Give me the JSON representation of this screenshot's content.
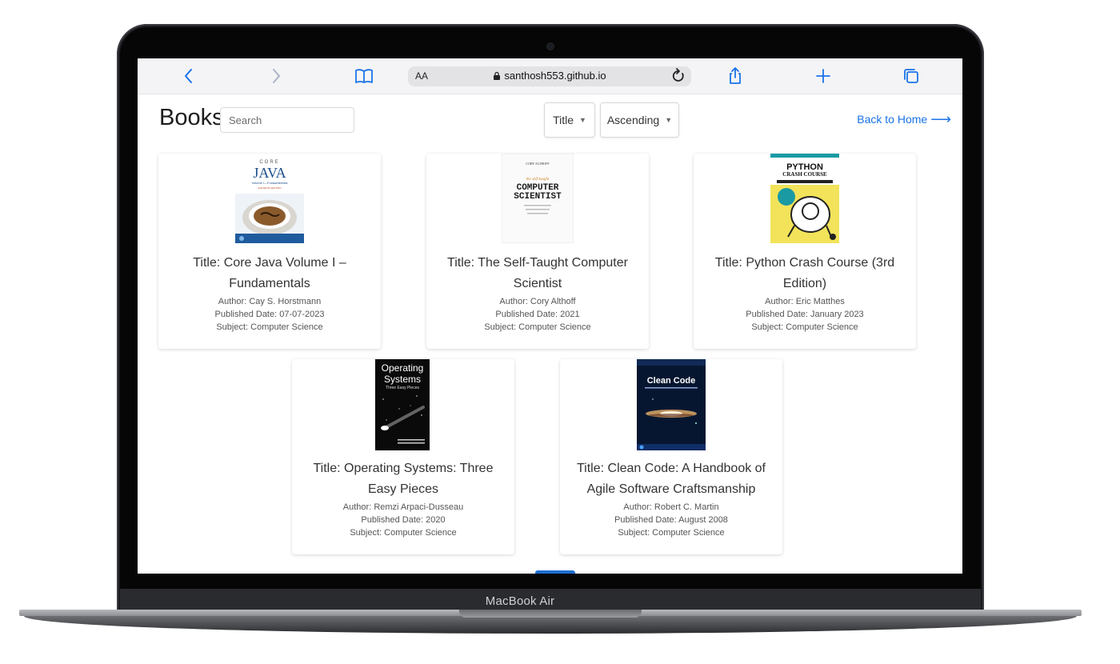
{
  "browser": {
    "aa_label": "AA",
    "url": "santhosh553.github.io",
    "icons": [
      "chevron-left-icon",
      "chevron-right-icon",
      "book-open-icon",
      "reload-icon",
      "share-icon",
      "plus-icon",
      "tabs-icon",
      "lock-icon"
    ]
  },
  "device": {
    "label": "MacBook Air"
  },
  "page": {
    "heading": "Books",
    "search_placeholder": "Search",
    "sort_field": "Title",
    "sort_order": "Ascending",
    "back_link": "Back to Home"
  },
  "cover_texts": {
    "java": {
      "top": "CORE",
      "name": "JAVA",
      "sub": "Volume I—Fundamentals",
      "ed": "ELEVENTH EDITION"
    },
    "cs": {
      "author": "CORY ALTHOFF",
      "tag": "the self-taught",
      "l1": "COMPUTER",
      "l2": "SCIENTIST"
    },
    "py": {
      "badge": "THIRD EDITION",
      "l1": "PYTHON",
      "l2": "CRASH COURSE"
    },
    "os": {
      "l1": "Operating",
      "l2": "Systems",
      "l3": "Three Easy Pieces"
    },
    "cc": {
      "l1": "Clean Code"
    }
  },
  "books": [
    {
      "title": "Title: Core Java Volume I – Fundamentals",
      "author": "Author: Cay S. Horstmann",
      "date": "Published Date: 07-07-2023",
      "subject": "Subject: Computer Science"
    },
    {
      "title": "Title: The Self-Taught Computer Scientist",
      "author": "Author: Cory Althoff",
      "date": "Published Date: 2021",
      "subject": "Subject: Computer Science"
    },
    {
      "title": "Title: Python Crash Course (3rd Edition)",
      "author": "Author: Eric Matthes",
      "date": "Published Date: January 2023",
      "subject": "Subject: Computer Science"
    },
    {
      "title": "Title: Operating Systems: Three Easy Pieces",
      "author": "Author: Remzi Arpaci-Dusseau",
      "date": "Published Date: 2020",
      "subject": "Subject: Computer Science"
    },
    {
      "title": "Title: Clean Code: A Handbook of Agile Software Craftsmanship",
      "author": "Author: Robert C. Martin",
      "date": "Published Date: August 2008",
      "subject": "Subject: Computer Science"
    }
  ],
  "colors": {
    "accent": "#1a73e8",
    "toolbar_bg": "#f4f4f6",
    "frame": "#1b1c1f"
  }
}
